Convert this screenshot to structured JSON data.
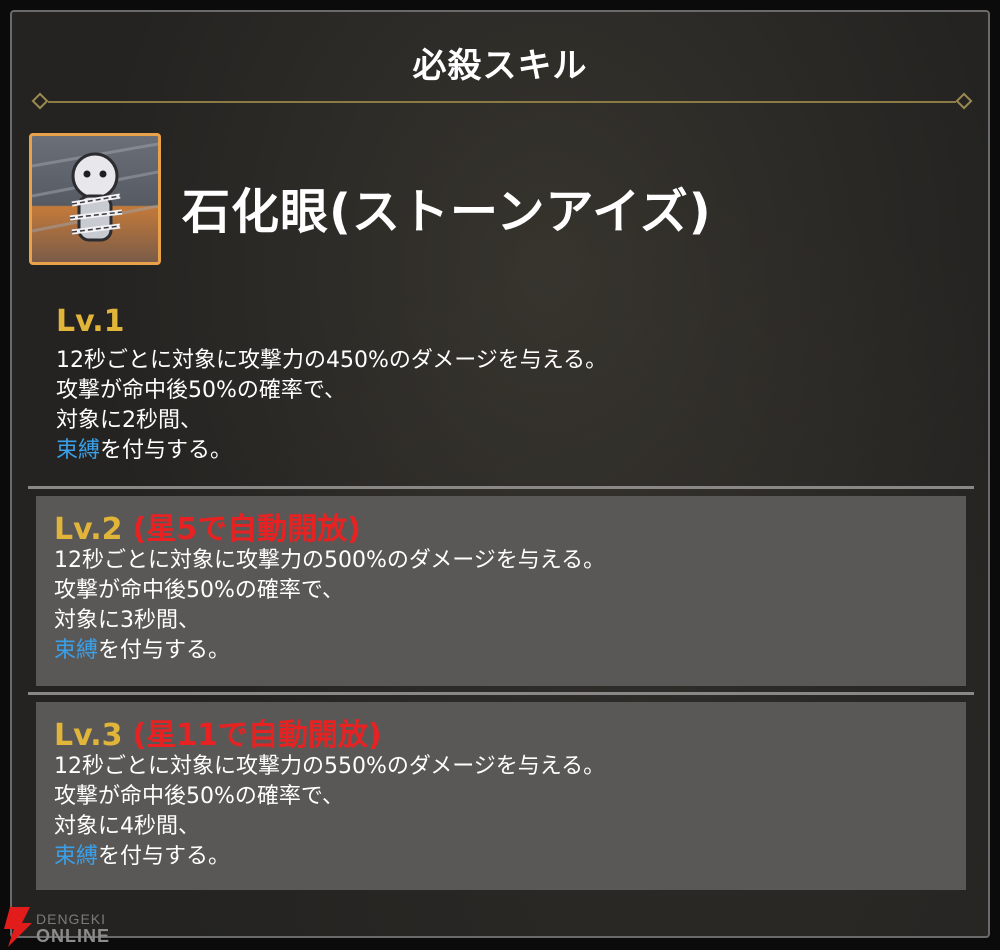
{
  "header": {
    "title": "必殺スキル"
  },
  "skill": {
    "icon": "chained-stone-figure-icon",
    "name": "石化眼(ストーンアイズ)"
  },
  "levels": [
    {
      "label": "Lv.1",
      "unlock": "",
      "lines": [
        "12秒ごとに対象に攻撃力の450%のダメージを与える。",
        "攻撃が命中後50%の確率で、",
        "対象に2秒間、"
      ],
      "keyword": "束縛",
      "keyword_suffix": "を付与する。"
    },
    {
      "label": "Lv.2",
      "unlock": "(星5で自動開放)",
      "lines": [
        "12秒ごとに対象に攻撃力の500%のダメージを与える。",
        "攻撃が命中後50%の確率で、",
        "対象に3秒間、"
      ],
      "keyword": "束縛",
      "keyword_suffix": "を付与する。"
    },
    {
      "label": "Lv.3",
      "unlock": "(星11で自動開放)",
      "lines": [
        "12秒ごとに対象に攻撃力の550%のダメージを与える。",
        "攻撃が命中後50%の確率で、",
        "対象に4秒間、"
      ],
      "keyword": "束縛",
      "keyword_suffix": "を付与する。"
    }
  ],
  "watermark": {
    "text_top": "DENGEKI",
    "text_bottom": "ONLINE"
  },
  "colors": {
    "level_label": "#e1b43a",
    "unlock_text": "#e62222",
    "keyword": "#3aa0ea",
    "icon_border": "#e9a24a"
  }
}
